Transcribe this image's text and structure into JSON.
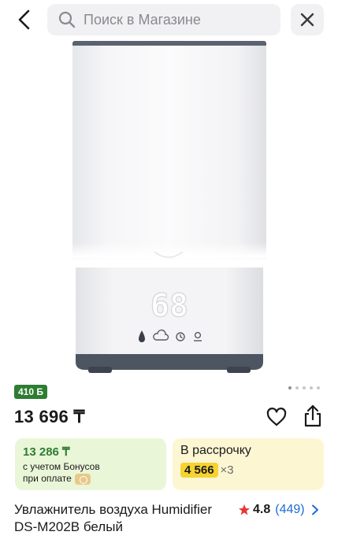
{
  "header": {
    "search_placeholder": "Поиск в Магазине",
    "back_icon": "chevron-left-icon",
    "search_icon": "search-icon",
    "close_icon": "close-icon"
  },
  "product": {
    "display_value": "68",
    "bonus_badge": "410 Б",
    "price": "13 696 ₸",
    "gallery": {
      "current": 1,
      "total": 5
    },
    "title_line1": "Увлажнитель воздуха Humidifier",
    "title_line2": "DS-M202B белый",
    "rating": "4.8",
    "reviews": "(449)"
  },
  "bonus_card": {
    "amount": "13 286 ₸",
    "line1": "с учетом Бонусов",
    "line2": "при оплате"
  },
  "credit_card": {
    "title": "В рассрочку",
    "monthly": "4 566",
    "multiplier": "×3"
  },
  "colors": {
    "accent_green": "#2e7d32",
    "bonus_bg": "#eaf6d8",
    "credit_bg": "#fdf6d3",
    "credit_pill": "#f6d330",
    "link_blue": "#1e6bd6",
    "star_red": "#e53935"
  }
}
